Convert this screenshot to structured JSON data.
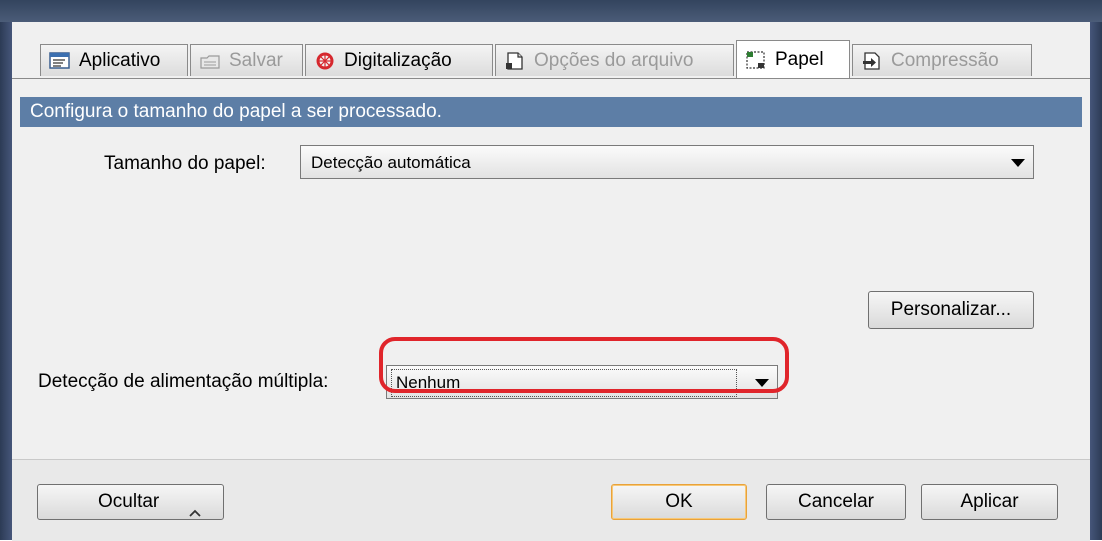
{
  "tabs": [
    {
      "label": "Aplicativo",
      "icon": "application-icon",
      "enabled": true
    },
    {
      "label": "Salvar",
      "icon": "save-folder-icon",
      "enabled": false
    },
    {
      "label": "Digitalização",
      "icon": "scan-icon",
      "enabled": true
    },
    {
      "label": "Opções do arquivo",
      "icon": "file-options-icon",
      "enabled": false
    },
    {
      "label": "Papel",
      "icon": "paper-icon",
      "enabled": true,
      "active": true
    },
    {
      "label": "Compressão",
      "icon": "compression-icon",
      "enabled": false
    }
  ],
  "panel": {
    "description": "Configura o tamanho do papel a ser processado.",
    "paper_size": {
      "label": "Tamanho do papel:",
      "value": "Detecção automática"
    },
    "customize_button": "Personalizar...",
    "multifeed": {
      "label": "Detecção de alimentação múltipla:",
      "value": "Nenhum"
    }
  },
  "footer": {
    "hide_button": "Ocultar",
    "ok_button": "OK",
    "cancel_button": "Cancelar",
    "apply_button": "Aplicar"
  },
  "colors": {
    "description_bar": "#5d7ea6",
    "highlight": "#e0252b",
    "default_button_border": "#e9a23a"
  }
}
